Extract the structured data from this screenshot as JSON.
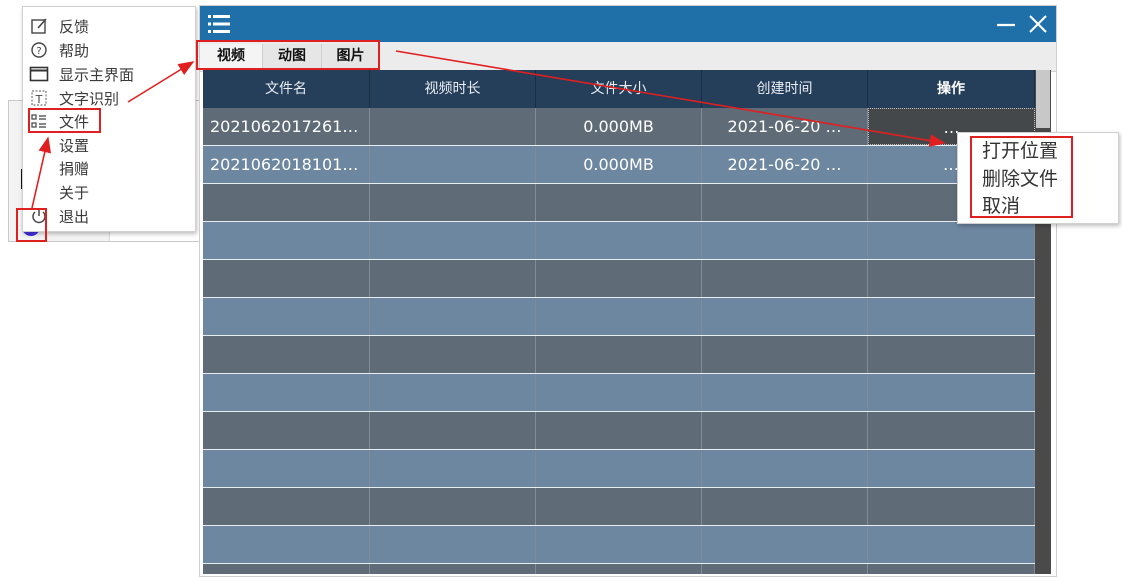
{
  "tray_menu": {
    "items": [
      {
        "label": "反馈",
        "icon": "edit-icon"
      },
      {
        "label": "帮助",
        "icon": "help-circle-icon"
      },
      {
        "label": "显示主界面",
        "icon": "window-icon"
      },
      {
        "label": "文字识别",
        "icon": "text-recognition-icon"
      },
      {
        "label": "文件",
        "icon": "file-list-icon"
      },
      {
        "label": "设置",
        "icon": ""
      },
      {
        "label": "捐赠",
        "icon": ""
      },
      {
        "label": "关于",
        "icon": ""
      },
      {
        "label": "退出",
        "icon": "power-icon"
      }
    ]
  },
  "window": {
    "tabs": [
      {
        "label": "视频",
        "active": true
      },
      {
        "label": "动图",
        "active": false
      },
      {
        "label": "图片",
        "active": false
      }
    ],
    "table": {
      "columns": [
        "文件名",
        "视频时长",
        "文件大小",
        "创建时间",
        "操作"
      ],
      "rows": [
        {
          "name": "2021062017261…",
          "duration": "",
          "size": "0.000MB",
          "created": "2021-06-20 …",
          "action": "…"
        },
        {
          "name": "2021062018101…",
          "duration": "",
          "size": "0.000MB",
          "created": "2021-06-20 …",
          "action": "…"
        }
      ],
      "empty_row_count": 11
    }
  },
  "op_menu": {
    "items": [
      "打开位置",
      "删除文件",
      "取消"
    ]
  },
  "colors": {
    "titlebar": "#1f6fa8",
    "header": "#253e5a",
    "row_dark": "#5f6b76",
    "row_light": "#6d87a0",
    "annotation": "#e02020"
  }
}
